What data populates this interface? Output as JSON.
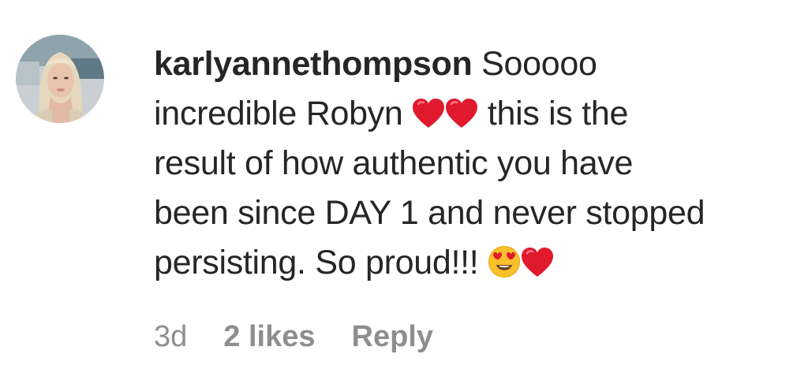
{
  "comment": {
    "username": "karlyannethompson",
    "text_lines": [
      "Sooooo",
      "incredible Robyn",
      "this is the",
      "result of how authentic you have",
      "been since DAY 1 and never stopped",
      "persisting. So proud!!!"
    ],
    "emojis": [
      "red-heart",
      "red-heart",
      "smiling-face-with-heart-eyes",
      "red-heart"
    ],
    "timestamp": "3d",
    "likes": "2 likes",
    "reply_label": "Reply"
  },
  "colors": {
    "text": "#262626",
    "meta": "#8e8e8e",
    "heart": "#e0192d"
  }
}
